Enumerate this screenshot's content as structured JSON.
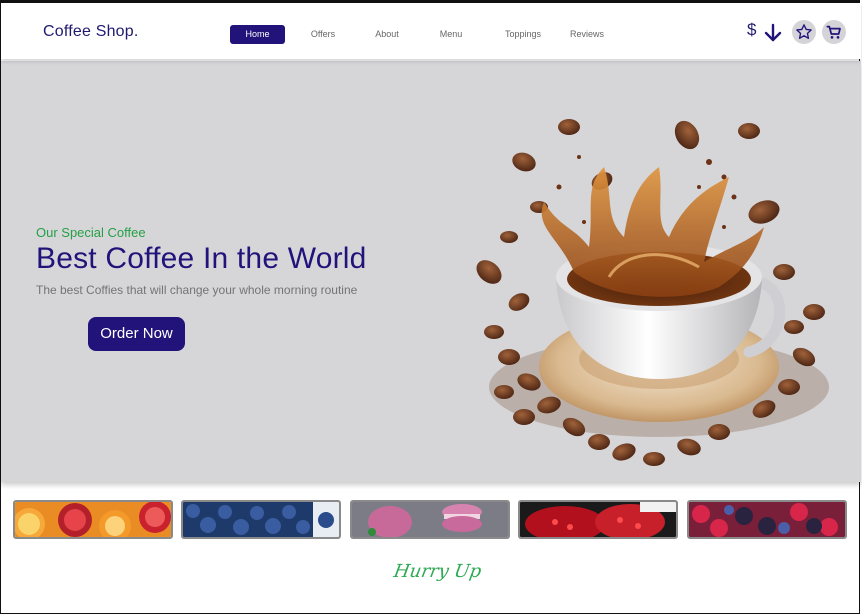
{
  "brand": {
    "name": "Coffee Shop."
  },
  "nav": {
    "items": [
      {
        "label": "Home",
        "active": true
      },
      {
        "label": "Offers",
        "active": false
      },
      {
        "label": "About",
        "active": false
      },
      {
        "label": "Menu",
        "active": false
      },
      {
        "label": "Toppings",
        "active": false
      },
      {
        "label": "Reviews",
        "active": false
      }
    ]
  },
  "tools": {
    "currency": "$",
    "icons": [
      "arrow-down-icon",
      "star-icon",
      "cart-icon"
    ]
  },
  "hero": {
    "kicker": "Our Special Coffee",
    "headline": "Best Coffee In the World",
    "subline": "The best Coffies that will change your whole morning routine",
    "cta": "Order Now",
    "image": "coffee-splash-image"
  },
  "strip": {
    "images": [
      "oranges-image",
      "blueberries-image",
      "macarons-image",
      "pomegranate-image",
      "berries-image"
    ]
  },
  "footer": {
    "hurry": "Hurry Up"
  },
  "colors": {
    "primary": "#22137a",
    "accent": "#25a046",
    "hero_bg": "#d6d6d9"
  }
}
